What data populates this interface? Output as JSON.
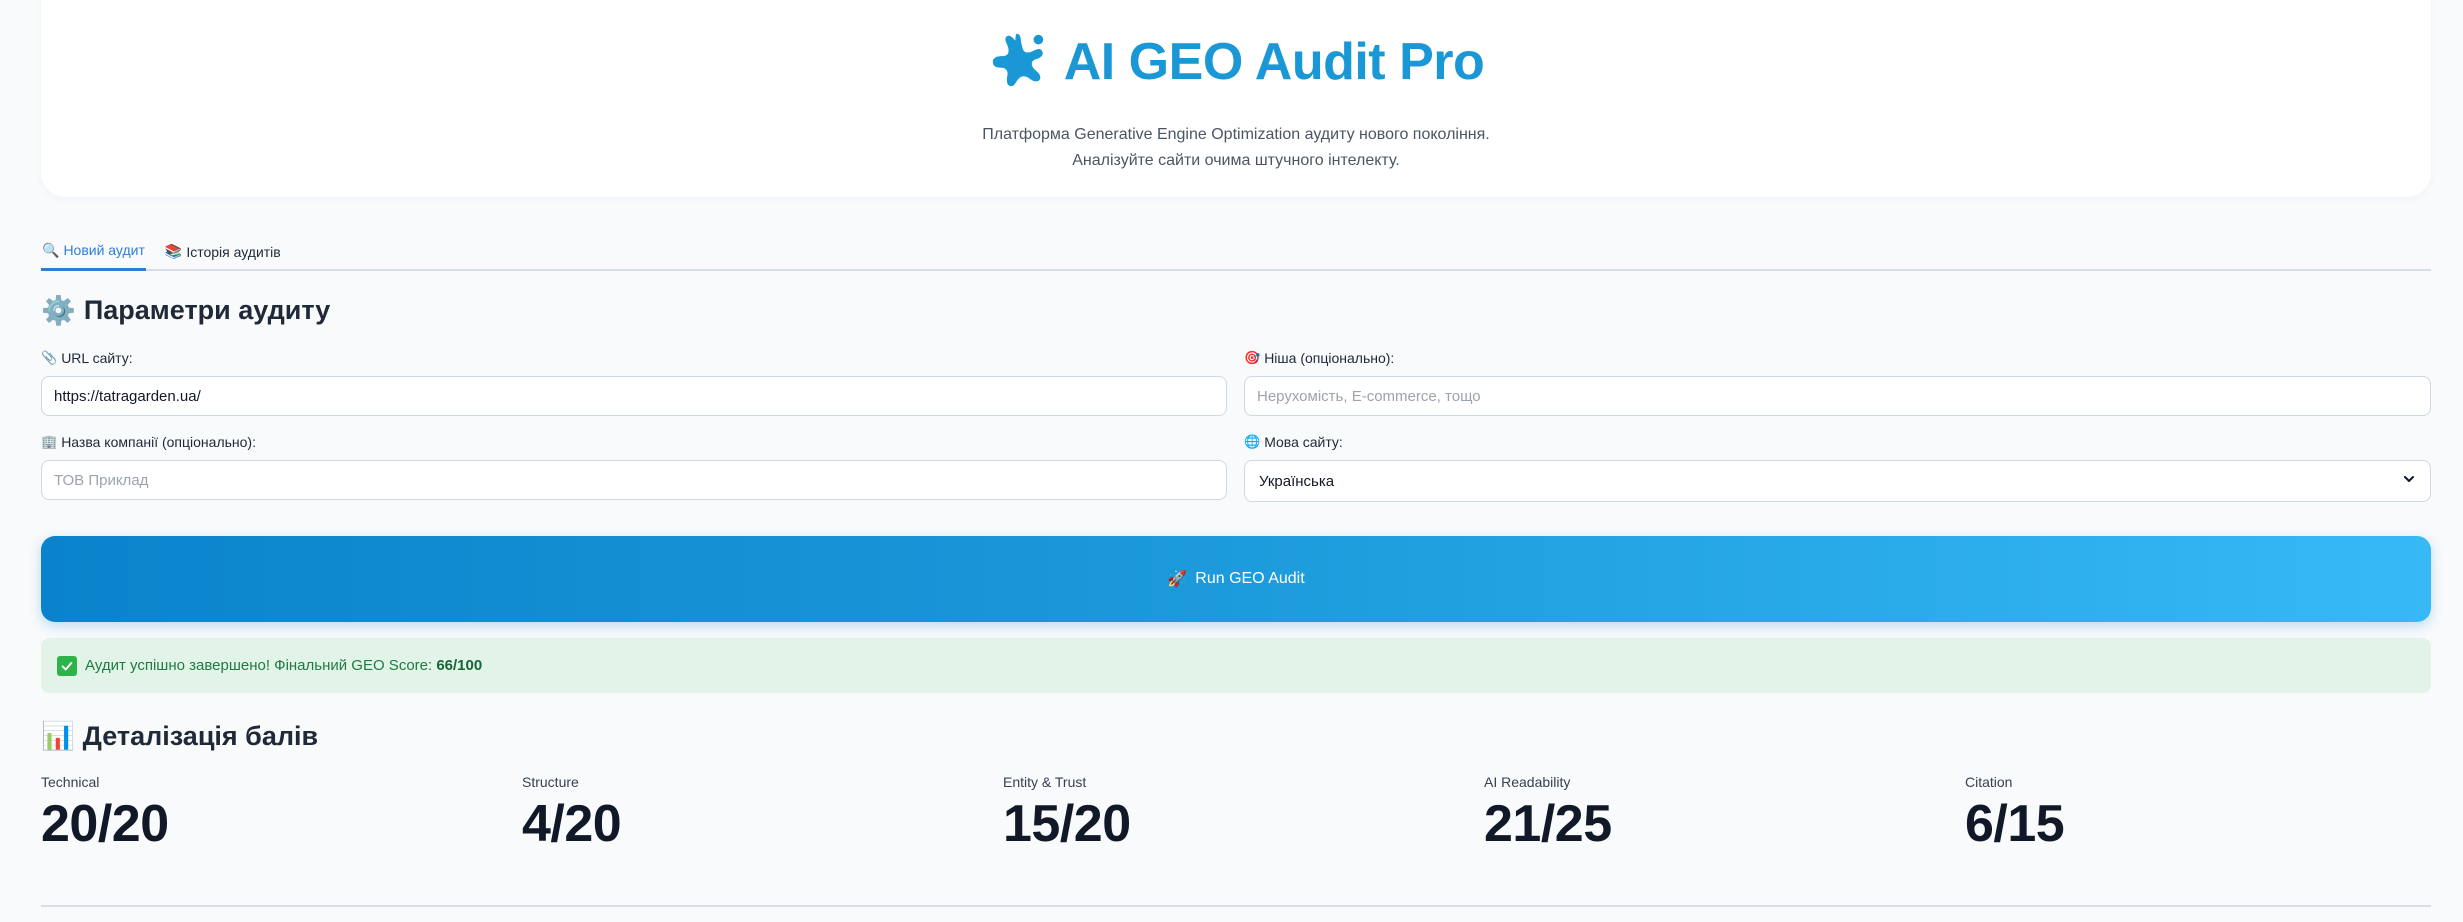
{
  "header": {
    "title": "AI GEO Audit Pro",
    "icon": "sparkle-icon",
    "subtitle_line1": "Платформа Generative Engine Optimization аудиту нового покоління.",
    "subtitle_line2": "Аналізуйте сайти очима штучного інтелекту.",
    "accent_color": "#1a98d5"
  },
  "tabs": [
    {
      "icon": "🔍",
      "label": "Новий аудит",
      "active": true
    },
    {
      "icon": "📚",
      "label": "Історія аудитів",
      "active": false
    }
  ],
  "params": {
    "icon": "⚙️",
    "title": "Параметри аудиту",
    "url_label": "URL сайту:",
    "url_icon": "📎",
    "url_value": "https://tatragarden.ua/",
    "niche_label": "Ніша (опціонально):",
    "niche_icon": "🎯",
    "niche_placeholder": "Нерухомість, E-commerce, тощо",
    "company_label": "Назва компанії (опціонально):",
    "company_icon": "🏢",
    "company_placeholder": "ТОВ Приклад",
    "lang_label": "Мова сайту:",
    "lang_icon": "🌐",
    "lang_value": "Українська"
  },
  "run_button": {
    "icon": "🚀",
    "label": "Run GEO Audit"
  },
  "alert": {
    "icon": "✅",
    "text": "Аудит успішно завершено! Фінальний GEO Score: ",
    "score": "66/100"
  },
  "details": {
    "icon": "📊",
    "title": "Деталізація балів",
    "metrics": [
      {
        "label": "Technical",
        "value": "20/20"
      },
      {
        "label": "Structure",
        "value": "4/20"
      },
      {
        "label": "Entity & Trust",
        "value": "15/20"
      },
      {
        "label": "AI Readability",
        "value": "21/25"
      },
      {
        "label": "Citation",
        "value": "6/15"
      }
    ]
  }
}
